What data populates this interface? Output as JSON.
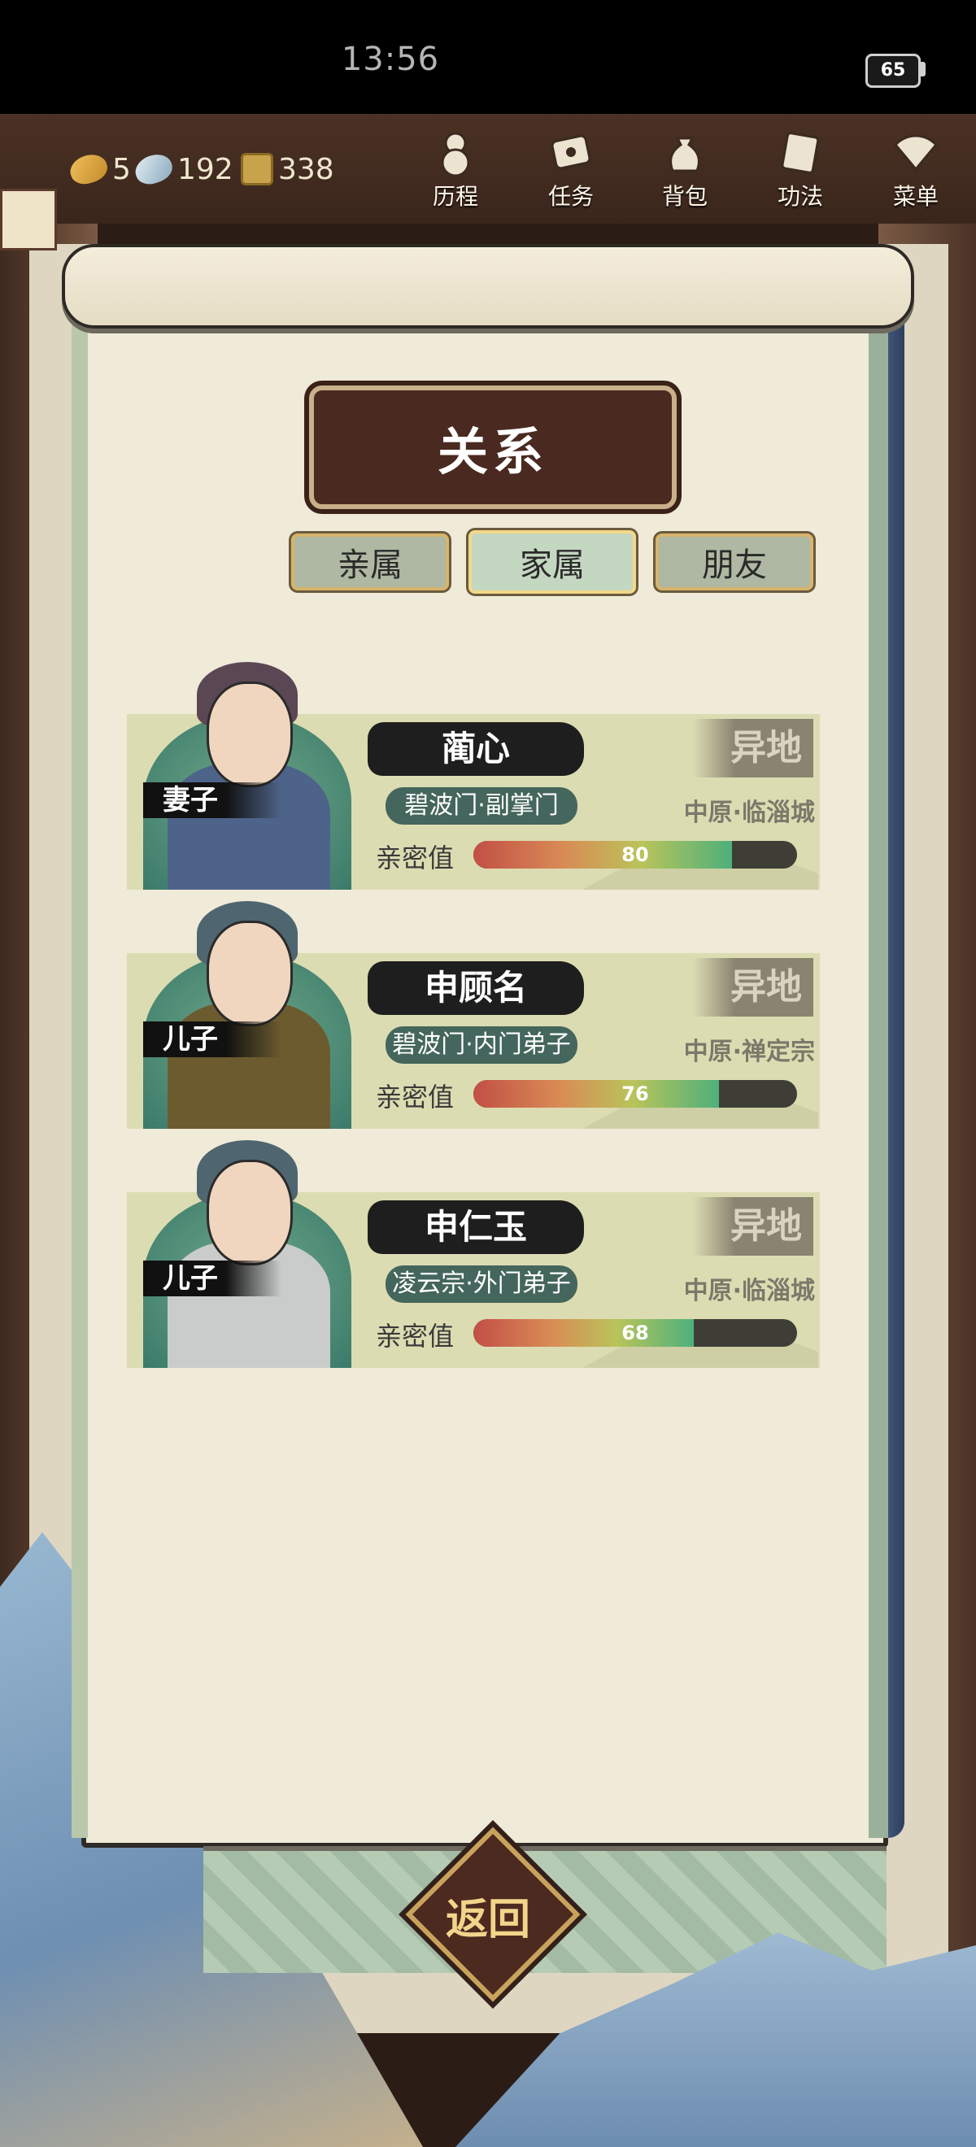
{
  "status_bar": {
    "time": "13:56",
    "battery": "65"
  },
  "resources": {
    "leaf": "5",
    "feather": "192",
    "coin": "338"
  },
  "top_menu": [
    {
      "label": "历程",
      "icon": "history-gourd-icon"
    },
    {
      "label": "任务",
      "icon": "tasks-scroll-icon"
    },
    {
      "label": "背包",
      "icon": "bag-icon"
    },
    {
      "label": "功法",
      "icon": "skills-book-icon"
    },
    {
      "label": "菜单",
      "icon": "menu-fan-icon"
    }
  ],
  "panel": {
    "title": "关系"
  },
  "tabs": [
    {
      "label": "亲属",
      "selected": false
    },
    {
      "label": "家属",
      "selected": true
    },
    {
      "label": "朋友",
      "selected": false
    }
  ],
  "characters": [
    {
      "name": "蔺心",
      "relation": "妻子",
      "sect": "碧波门·副掌门",
      "intimacy_label": "亲密值",
      "intimacy": 80,
      "status": "异地",
      "location": "中原·临淄城"
    },
    {
      "name": "申顾名",
      "relation": "儿子",
      "sect": "碧波门·内门弟子",
      "intimacy_label": "亲密值",
      "intimacy": 76,
      "status": "异地",
      "location": "中原·禅定宗"
    },
    {
      "name": "申仁玉",
      "relation": "儿子",
      "sect": "凌云宗·外门弟子",
      "intimacy_label": "亲密值",
      "intimacy": 68,
      "status": "异地",
      "location": "中原·临淄城"
    }
  ],
  "back_button": {
    "label": "返回"
  },
  "colors": {
    "accent": "#d7b56c",
    "panel_dark": "#4a2a20",
    "intimacy_high": "#4db07b",
    "intimacy_low": "#c24f46"
  }
}
